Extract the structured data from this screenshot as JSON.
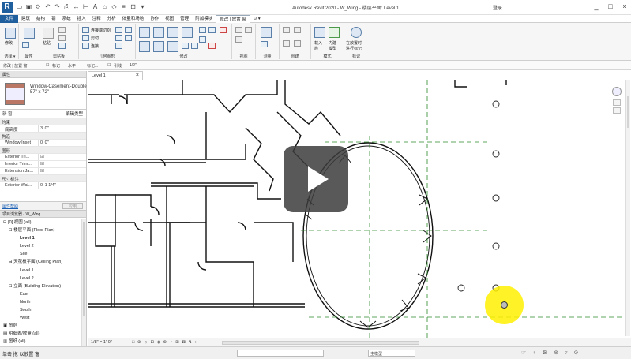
{
  "window": {
    "app_logo": "R",
    "title": "Autodesk Revit 2020 - W_Wing - 楼层平面: Level 1",
    "user": "登录",
    "controls": [
      "_",
      "□",
      "×"
    ]
  },
  "ribbon_tabs": [
    {
      "label": "文件",
      "style": "file"
    },
    {
      "label": "建筑"
    },
    {
      "label": "结构"
    },
    {
      "label": "钢"
    },
    {
      "label": "系统"
    },
    {
      "label": "插入"
    },
    {
      "label": "注释"
    },
    {
      "label": "分析"
    },
    {
      "label": "体量和场地"
    },
    {
      "label": "协作"
    },
    {
      "label": "视图"
    },
    {
      "label": "管理"
    },
    {
      "label": "附加模块"
    },
    {
      "label": "修改 | 放置 窗",
      "style": "active"
    },
    {
      "label": "⊙ ▾"
    }
  ],
  "ribbon": {
    "modify_label": "修改",
    "paste_label": "粘贴",
    "cope_label": "连接端切割",
    "cut_label": "剪切",
    "join_label": "连接",
    "load_family_label": "载入\n族",
    "create_label": "内建\n模型",
    "tag_label": "在放置时\n进行标记",
    "groups": [
      "选择 ▾",
      "属性",
      "剪贴板",
      "几何图形",
      "修改",
      "视图",
      "测量",
      "创建",
      "模式",
      "标记"
    ]
  },
  "option_bar": {
    "label": "修改 | 放置 窗",
    "tag_checkbox": "标记",
    "orientation": "水平",
    "leader": "引线",
    "offset": "1/2\""
  },
  "properties": {
    "header": "属性",
    "type_name": "Window-Casement-Double\n57\" x 72\"",
    "instance_selector": "新 窗",
    "edit_type": "编辑类型",
    "rows": [
      {
        "key": "约束",
        "cat": true
      },
      {
        "key": "底高度",
        "value": "3'  0\""
      },
      {
        "key": "构造",
        "cat": true
      },
      {
        "key": "Window Inset",
        "value": "0'  0\""
      },
      {
        "key": "图形",
        "cat": true
      },
      {
        "key": "Exterior Tri...",
        "value": "☑"
      },
      {
        "key": "Interior Trim...",
        "value": "☑"
      },
      {
        "key": "Extension Ja...",
        "value": "☑"
      },
      {
        "key": "尺寸标注",
        "cat": true
      },
      {
        "key": "Exterior Wal...",
        "value": "0'  1 1/4\""
      }
    ],
    "help_link": "属性帮助",
    "apply_button": "应用"
  },
  "project_browser": {
    "header": "项目浏览器 - W_Wing",
    "nodes": [
      {
        "label": "⊟ [0] 视图 (all)",
        "depth": 0
      },
      {
        "label": "⊟ 楼层平面 (Floor Plan)",
        "depth": 1
      },
      {
        "label": "Level 1",
        "depth": 3,
        "bold": true
      },
      {
        "label": "Level 2",
        "depth": 3
      },
      {
        "label": "Site",
        "depth": 3
      },
      {
        "label": "⊟ 天花板平面 (Ceiling Plan)",
        "depth": 1
      },
      {
        "label": "Level 1",
        "depth": 3
      },
      {
        "label": "Level 2",
        "depth": 3
      },
      {
        "label": "⊟ 立面 (Building Elevation)",
        "depth": 1
      },
      {
        "label": "East",
        "depth": 3
      },
      {
        "label": "North",
        "depth": 3
      },
      {
        "label": "South",
        "depth": 3
      },
      {
        "label": "West",
        "depth": 3
      },
      {
        "label": "▣ 图例",
        "depth": 0
      },
      {
        "label": "▤ 明细表/数量 (all)",
        "depth": 0
      },
      {
        "label": "▥ 图纸 (all)",
        "depth": 0
      }
    ]
  },
  "view_tab": {
    "label": "Level 1",
    "close": "×"
  },
  "view_bar": {
    "scale": "1/8\" = 1'-0\"",
    "icons": "□ ⊕ ☼ ⊡ ◈ ⊛ ♀ ⊞ ⊠ ↯ ‹"
  },
  "status_bar": {
    "message": "单击 拖 以放置 窗",
    "field1": "",
    "field2": "主模型",
    "icons": "☞ ♀ ⊠ ⊛ ▿ ⊙"
  },
  "play_button": {
    "state": "paused-overlay"
  }
}
